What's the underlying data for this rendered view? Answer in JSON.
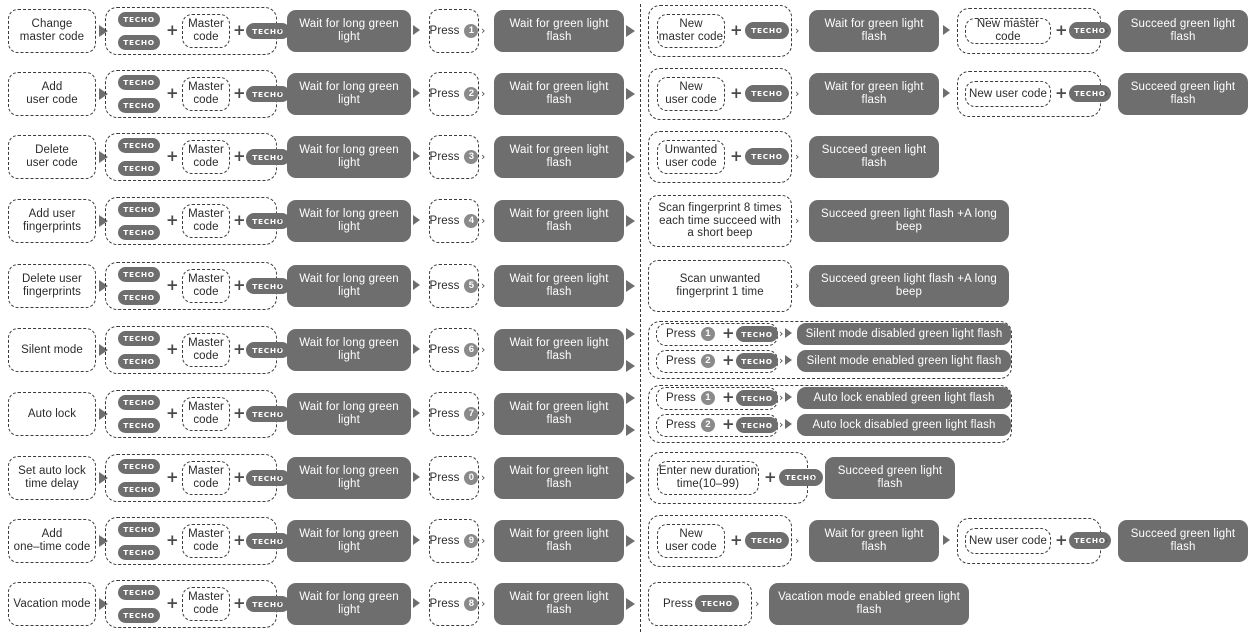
{
  "diagram": {
    "title": "Smart lock programming flow chart",
    "brand_badge_label": "TECHO",
    "plus_symbol": "+",
    "chevron_symbol": "›",
    "colors": {
      "solid_fill": "#6e6e6e",
      "solid_text": "#ffffff",
      "dashed_border": "#3a3a3a",
      "dashed_text": "#2b2b2b",
      "badge_fill": "#8a8a8a",
      "background": "#ffffff"
    },
    "common": {
      "master_code": "Master\ncode",
      "wait_long_green": "Wait for long green light",
      "wait_green_flash": "Wait for green light flash",
      "press": "Press",
      "succeed_green_flash": "Succeed green light flash",
      "succeed_green_flash_beep": "Succeed green light flash +A long beep"
    },
    "rows": [
      {
        "id": "change-master-code",
        "label": "Change\nmaster code",
        "press_digit": "1",
        "step_after": {
          "input": "New\nmaster code",
          "has_badge": true
        },
        "tail": [
          {
            "kind": "solid",
            "text": "Wait for green light flash"
          },
          {
            "kind": "group-input",
            "input": "New master code",
            "has_badge": true
          },
          {
            "kind": "solid",
            "text": "Succeed green light flash"
          }
        ]
      },
      {
        "id": "add-user-code",
        "label": "Add\nuser code",
        "press_digit": "2",
        "step_after": {
          "input": "New\nuser code",
          "has_badge": true
        },
        "tail": [
          {
            "kind": "solid",
            "text": "Wait for green light flash"
          },
          {
            "kind": "group-input",
            "input": "New user code",
            "has_badge": true
          },
          {
            "kind": "solid",
            "text": "Succeed green light flash"
          }
        ]
      },
      {
        "id": "delete-user-code",
        "label": "Delete\nuser code",
        "press_digit": "3",
        "step_after": {
          "input": "Unwanted\nuser code",
          "has_badge": true
        },
        "tail": [
          {
            "kind": "solid",
            "text": "Succeed green light flash"
          }
        ]
      },
      {
        "id": "add-user-fingerprints",
        "label": "Add user\nfingerprints",
        "press_digit": "4",
        "step_after": {
          "input": "Scan fingerprint 8 times\neach time succeed with\na short beep",
          "has_badge": false,
          "plain": true
        },
        "tail": [
          {
            "kind": "solid",
            "text": "Succeed green light flash +A long beep"
          }
        ]
      },
      {
        "id": "delete-user-fingerprints",
        "label": "Delete user\nfingerprints",
        "press_digit": "5",
        "step_after": {
          "input": "Scan unwanted\nfingerprint 1 time",
          "has_badge": false,
          "plain": true
        },
        "tail": [
          {
            "kind": "solid",
            "text": "Succeed green light flash +A long beep"
          }
        ]
      },
      {
        "id": "silent-mode",
        "label": "Silent mode",
        "press_digit": "6",
        "branches": [
          {
            "press": "Press",
            "digit": "1",
            "result": "Silent mode disabled green light flash"
          },
          {
            "press": "Press",
            "digit": "2",
            "result": "Silent mode enabled green light flash"
          }
        ]
      },
      {
        "id": "auto-lock",
        "label": "Auto lock",
        "press_digit": "7",
        "branches": [
          {
            "press": "Press",
            "digit": "1",
            "result": "Auto lock enabled green light flash"
          },
          {
            "press": "Press",
            "digit": "2",
            "result": "Auto lock disabled green light flash"
          }
        ]
      },
      {
        "id": "set-auto-lock-time-delay",
        "label": "Set auto lock\ntime delay",
        "press_digit": "0",
        "step_after": {
          "input": "Enter new duration\ntime(10–99)",
          "has_badge": true
        },
        "tail": [
          {
            "kind": "solid",
            "text": "Succeed green light flash"
          }
        ]
      },
      {
        "id": "add-one-time-code",
        "label": "Add\none–time code",
        "press_digit": "9",
        "step_after": {
          "input": "New\nuser code",
          "has_badge": true
        },
        "tail": [
          {
            "kind": "solid",
            "text": "Wait for green light flash"
          },
          {
            "kind": "group-input",
            "input": "New user code",
            "has_badge": true
          },
          {
            "kind": "solid",
            "text": "Succeed green light flash"
          }
        ]
      },
      {
        "id": "vacation-mode",
        "label": "Vacation mode",
        "press_digit": "8",
        "press_only": {
          "press": "Press",
          "has_badge": true
        },
        "tail": [
          {
            "kind": "solid",
            "text": "Vacation mode enabled green light flash"
          }
        ]
      }
    ]
  }
}
